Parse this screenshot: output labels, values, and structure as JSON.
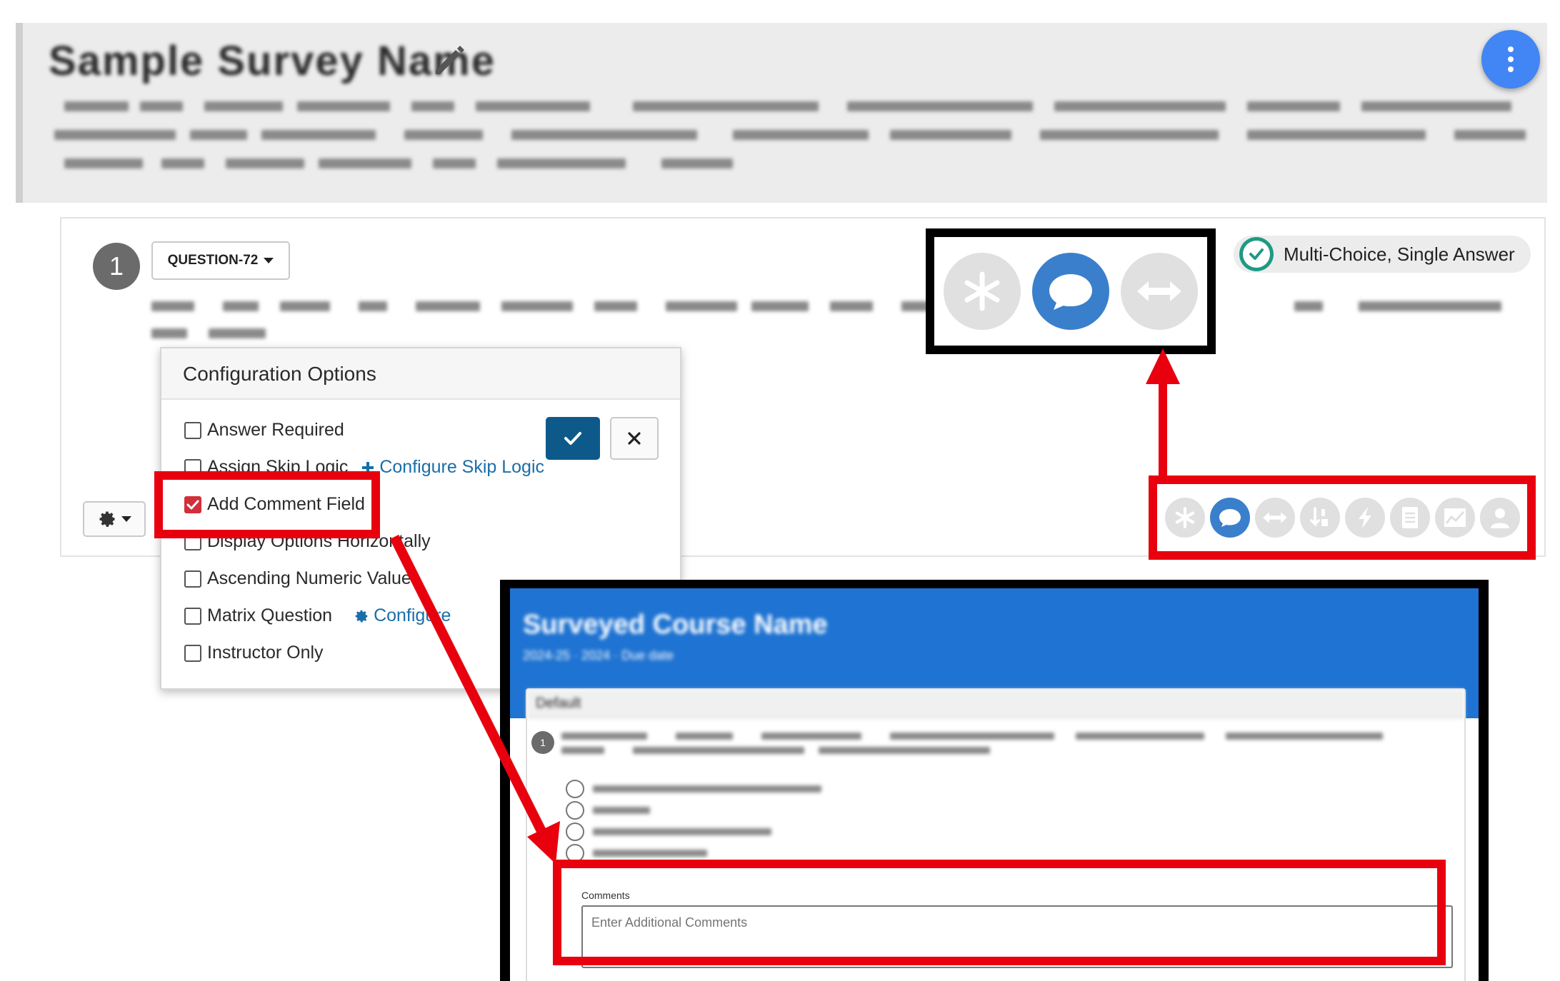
{
  "header": {
    "survey_title": "Sample Survey Name"
  },
  "question": {
    "number": "1",
    "id_label": "QUESTION-72",
    "type_label": "Multi-Choice, Single Answer"
  },
  "config": {
    "title": "Configuration Options",
    "options": {
      "answer_required": "Answer Required",
      "assign_skip_logic": "Assign Skip Logic",
      "configure_skip_logic": "Configure Skip Logic",
      "add_comment_field": "Add Comment Field",
      "display_horizontally": "Display Options Horizontally",
      "ascending_numeric": "Ascending Numeric Values",
      "matrix_question": "Matrix Question",
      "configure": "Configure",
      "instructor_only": "Instructor Only"
    },
    "checked": {
      "answer_required": false,
      "assign_skip_logic": false,
      "add_comment_field": true,
      "display_horizontally": false,
      "ascending_numeric": false,
      "matrix_question": false,
      "instructor_only": false
    }
  },
  "toolbar": {
    "icons": [
      "asterisk-icon",
      "comment-icon",
      "arrows-horizontal-icon",
      "sort-numeric-icon",
      "lightning-icon",
      "document-icon",
      "chart-icon",
      "user-icon"
    ],
    "active_icon": "comment-icon"
  },
  "preview": {
    "title": "Surveyed Course Name",
    "subtitle": "2024-25  ·  2024  ·  Due date",
    "section": "Default",
    "question_number": "1",
    "comments_label": "Comments",
    "comments_placeholder": "Enter Additional Comments"
  },
  "colors": {
    "fab": "#4285f4",
    "active_icon": "#3a7fcc",
    "check_badge": "#1e9a84",
    "ok_button": "#0d5a8a",
    "highlight": "#e8000e",
    "preview_header": "#1f73d2",
    "link": "#1a6ea8"
  }
}
